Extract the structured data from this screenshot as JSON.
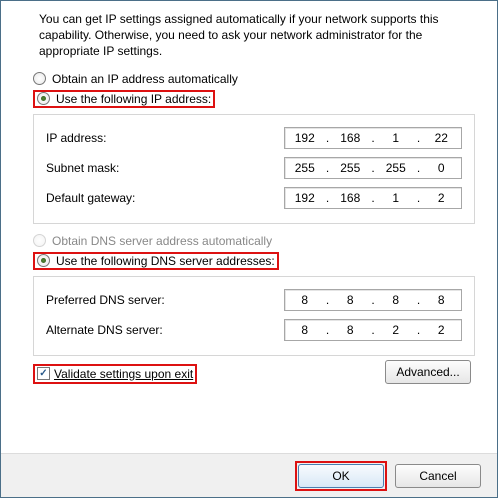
{
  "description": "You can get IP settings assigned automatically if your network supports this capability. Otherwise, you need to ask your network administrator for the appropriate IP settings.",
  "ip_section": {
    "auto_label": "Obtain an IP address automatically",
    "manual_label": "Use the following IP address:",
    "fields": {
      "ip": {
        "label": "IP address:",
        "oct": [
          "192",
          "168",
          "1",
          "22"
        ]
      },
      "subnet": {
        "label": "Subnet mask:",
        "oct": [
          "255",
          "255",
          "255",
          "0"
        ]
      },
      "gateway": {
        "label": "Default gateway:",
        "oct": [
          "192",
          "168",
          "1",
          "2"
        ]
      }
    }
  },
  "dns_section": {
    "auto_label": "Obtain DNS server address automatically",
    "manual_label": "Use the following DNS server addresses:",
    "fields": {
      "preferred": {
        "label": "Preferred DNS server:",
        "oct": [
          "8",
          "8",
          "8",
          "8"
        ]
      },
      "alternate": {
        "label": "Alternate DNS server:",
        "oct": [
          "8",
          "8",
          "2",
          "2"
        ]
      }
    }
  },
  "validate_label": "Validate settings upon exit",
  "buttons": {
    "advanced": "Advanced...",
    "ok": "OK",
    "cancel": "Cancel"
  }
}
